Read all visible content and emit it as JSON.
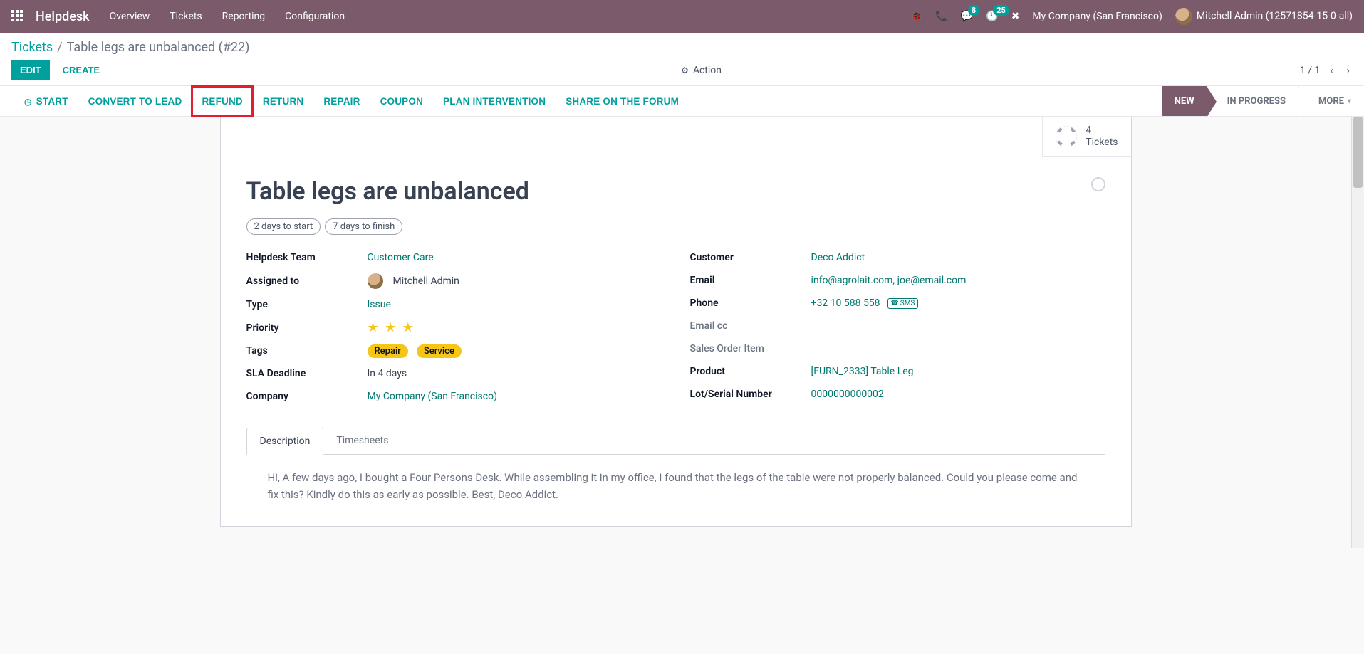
{
  "topbar": {
    "brand": "Helpdesk",
    "nav": [
      "Overview",
      "Tickets",
      "Reporting",
      "Configuration"
    ],
    "messages_badge": "8",
    "activities_badge": "25",
    "company": "My Company (San Francisco)",
    "user": "Mitchell Admin (12571854-15-0-all)"
  },
  "breadcrumb": {
    "root": "Tickets",
    "current": "Table legs are unbalanced (#22)"
  },
  "buttons": {
    "edit": "EDIT",
    "create": "CREATE",
    "action": "Action"
  },
  "pager": {
    "value": "1 / 1"
  },
  "workflow": {
    "start": "START",
    "convert": "CONVERT TO LEAD",
    "refund": "REFUND",
    "return": "RETURN",
    "repair": "REPAIR",
    "coupon": "COUPON",
    "plan": "PLAN INTERVENTION",
    "share": "SHARE ON THE FORUM"
  },
  "stages": {
    "new": "NEW",
    "in_progress": "IN PROGRESS",
    "more": "MORE"
  },
  "button_box": {
    "count": "4",
    "label": "Tickets"
  },
  "ticket": {
    "title": "Table legs are unbalanced",
    "sla": [
      "2 days to start",
      "7 days to finish"
    ],
    "labels": {
      "team": "Helpdesk Team",
      "assigned": "Assigned to",
      "type": "Type",
      "priority": "Priority",
      "tags": "Tags",
      "deadline": "SLA Deadline",
      "company": "Company",
      "customer": "Customer",
      "email": "Email",
      "phone": "Phone",
      "emailcc": "Email cc",
      "soi": "Sales Order Item",
      "product": "Product",
      "lot": "Lot/Serial Number"
    },
    "values": {
      "team": "Customer Care",
      "assigned": "Mitchell Admin",
      "type": "Issue",
      "deadline": "In 4 days",
      "company": "My Company (San Francisco)",
      "customer": "Deco Addict",
      "email": "info@agrolait.com, joe@email.com",
      "phone": "+32 10 588 558",
      "sms": "SMS",
      "product": "[FURN_2333] Table Leg",
      "lot": "0000000000002"
    },
    "tags": [
      "Repair",
      "Service"
    ]
  },
  "tabs": {
    "desc": "Description",
    "ts": "Timesheets"
  },
  "description": "Hi, A few days ago, I bought a Four Persons Desk. While assembling it in my office, I found that the legs of the table were not properly balanced. Could you please come and fix this? Kindly do this as early as possible. Best, Deco Addict."
}
